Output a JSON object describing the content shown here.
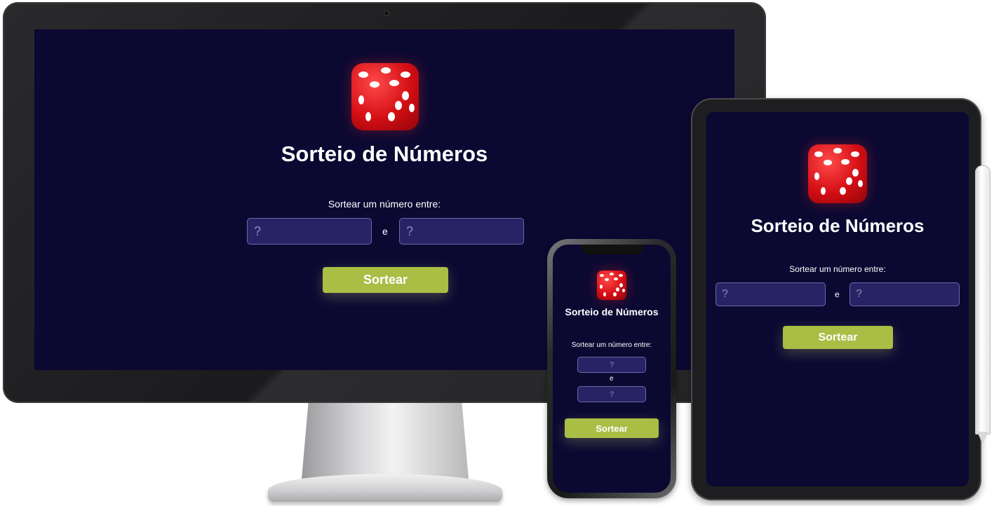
{
  "app": {
    "title": "Sorteio de Números",
    "prompt": "Sortear um número entre:",
    "min_placeholder": "?",
    "max_placeholder": "?",
    "separator": "e",
    "button_label": "Sortear",
    "icon": "dice-icon"
  },
  "colors": {
    "background": "#0b0932",
    "input_bg": "#272466",
    "button": "#aabd45",
    "dice": "#d40e14"
  }
}
